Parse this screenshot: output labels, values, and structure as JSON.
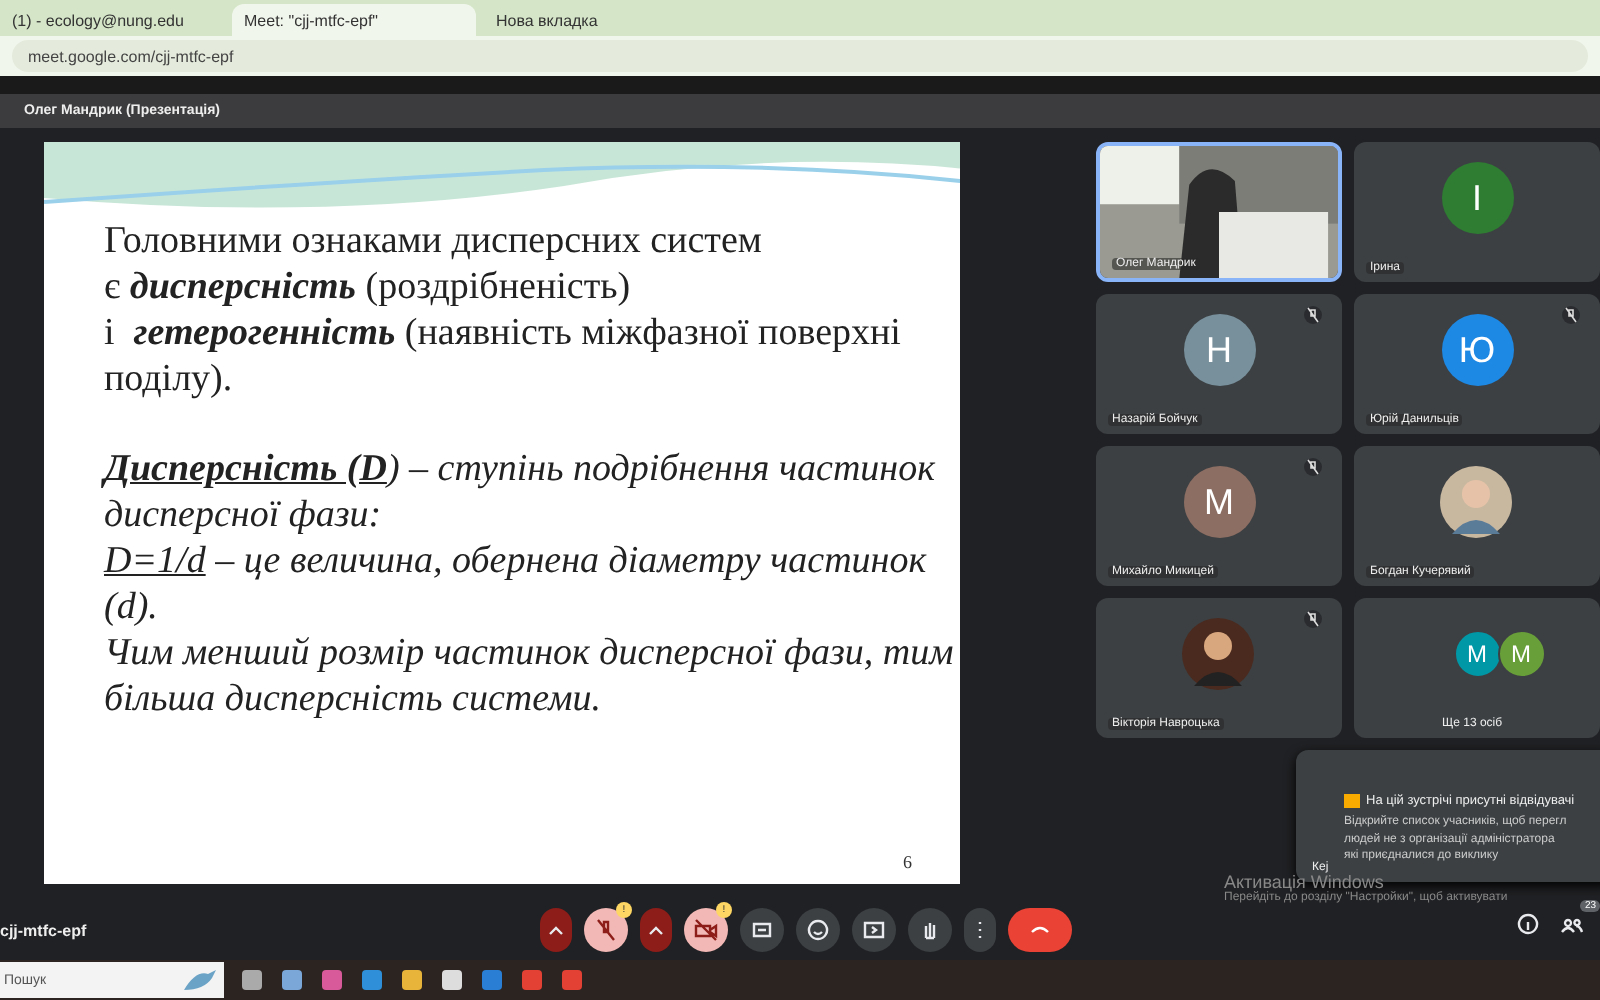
{
  "browser": {
    "tabs": [
      {
        "label": "(1) - ecology@nung.edu",
        "selected": false
      },
      {
        "label": "Meet: \"cjj-mtfc-epf\"",
        "selected": true
      },
      {
        "label": "Нова вкладка",
        "selected": false
      }
    ],
    "address": "meet.google.com/cjj-mtfc-epf"
  },
  "meet": {
    "presenter": "Олег Мандрик (Презентація)",
    "meeting_code": "cjj-mtfc-epf"
  },
  "slide": {
    "number": "6",
    "paragraphs": [
      [
        [
          {
            "kind": "plain",
            "text": "Головними ознаками дисперсних систем"
          }
        ],
        [
          {
            "kind": "plain",
            "text": "є "
          },
          {
            "kind": "emphasis",
            "text": "дисперсність"
          },
          {
            "kind": "plain",
            "text": " (роздрібненість)"
          }
        ],
        [
          {
            "kind": "plain",
            "text": "і  "
          },
          {
            "kind": "emphasis",
            "text": "гетерогенність"
          },
          {
            "kind": "plain",
            "text": " (наявність міжфазної поверхні"
          }
        ],
        [
          {
            "kind": "plain",
            "text": "поділу)."
          }
        ]
      ],
      [
        [
          {
            "kind": "term",
            "text": "Дисперсність (D"
          },
          {
            "kind": "italic",
            "text": ") – ступінь подрібнення частинок"
          }
        ],
        [
          {
            "kind": "italic",
            "text": "дисперсної фази:"
          }
        ],
        [
          {
            "kind": "formula",
            "text": "D=1/d"
          },
          {
            "kind": "italic",
            "text": " – це величина, обернена діаметру частинок"
          }
        ],
        [
          {
            "kind": "italic",
            "text": "(d)."
          }
        ],
        [
          {
            "kind": "italic",
            "text": "Чим менший розмір частинок дисперсної фази, тим"
          }
        ],
        [
          {
            "kind": "italic",
            "text": "більша дисперсність системи."
          }
        ]
      ]
    ]
  },
  "participants": [
    {
      "name": "Олег Мандрик",
      "kind": "video",
      "muted": false,
      "selected": true
    },
    {
      "name": "Ірина",
      "kind": "letter",
      "letter": "I",
      "color": "#2e7d32",
      "muted": false,
      "selected": false
    },
    {
      "name": "Назарій Бойчук",
      "kind": "letter",
      "letter": "Н",
      "color": "#78909c",
      "muted": true,
      "selected": false
    },
    {
      "name": "Юрій Данильців",
      "kind": "letter",
      "letter": "Ю",
      "color": "#1e88e5",
      "muted": true,
      "selected": false
    },
    {
      "name": "Михайло Микицей",
      "kind": "letter",
      "letter": "М",
      "color": "#8d6e63",
      "muted": true,
      "selected": false
    },
    {
      "name": "Богдан Кучерявий",
      "muted": false,
      "selected": false
    },
    {
      "name": "Вікторія Наврoцька",
      "muted": true,
      "selected": false
    },
    {
      "name": "Ще 13 осіб",
      "kind": "more",
      "letters": [
        {
          "letter": "М",
          "color": "#0097a7"
        },
        {
          "letter": "М",
          "color": "#689f38"
        }
      ],
      "muted": false,
      "selected": false
    }
  ],
  "toast": {
    "title": "На цій зустрічі присутні відвідувачі",
    "lines": [
      "Відкрийте список учасників, щоб перегл",
      "людей не з організації адміністратора",
      "які приєдналися до виклику"
    ],
    "side_label": "Кеј"
  },
  "watermark_os": {
    "title": "Активація Windows",
    "text": "Перейдіть до розділу \"Настройки\", щоб активувати"
  },
  "controls": {
    "mic_muted": true,
    "camera_off": true,
    "mic_badge": "!",
    "camera_badge": "!",
    "people_count": "23"
  },
  "taskbar": {
    "search_placeholder": "Пошук"
  }
}
